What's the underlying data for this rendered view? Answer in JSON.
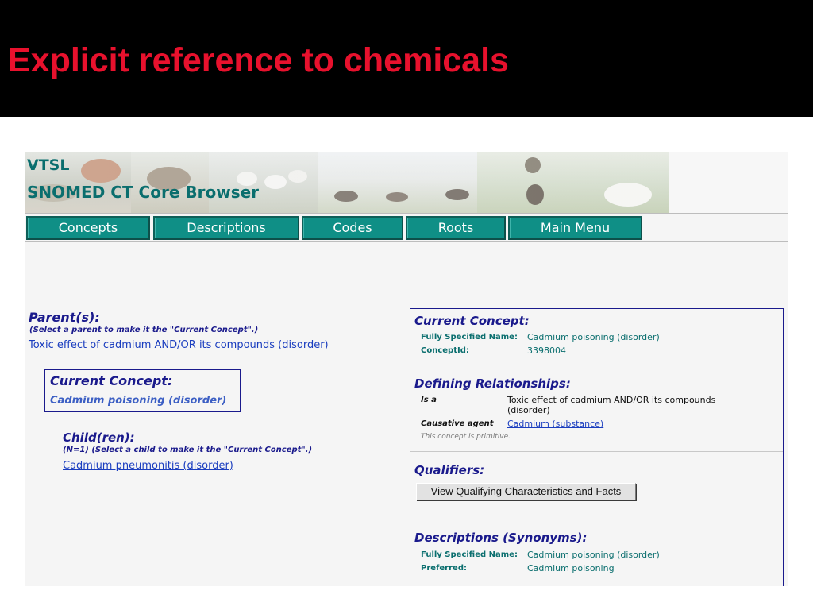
{
  "slide": {
    "title": "Explicit reference to chemicals"
  },
  "browser": {
    "brand": "VTSL",
    "title": "SNOMED CT Core Browser",
    "nav": [
      {
        "label": "Concepts"
      },
      {
        "label": "Descriptions"
      },
      {
        "label": "Codes"
      },
      {
        "label": "Roots"
      },
      {
        "label": "Main Menu"
      }
    ],
    "colors": {
      "accent": "#0f8f86",
      "heading": "#1a1a8c",
      "teal_text": "#0a6e6e",
      "link": "#1a3dbf",
      "slide_title": "#e8112d"
    }
  },
  "left_pane": {
    "parents_heading": "Parent(s):",
    "parents_note": "(Select a parent to make it the \"Current Concept\".)",
    "parent_link": "Toxic effect of cadmium AND/OR its compounds (disorder)",
    "current_concept_label": "Current Concept:",
    "current_concept_value": "Cadmium poisoning (disorder)",
    "children_heading": "Child(ren):",
    "children_note": "(N=1) (Select a child to make it the \"Current Concept\".)",
    "child_link": "Cadmium pneumonitis (disorder)"
  },
  "right_panel": {
    "current_concept": {
      "heading": "Current Concept:",
      "fsn_label": "Fully Specified Name:",
      "fsn_value": "Cadmium poisoning (disorder)",
      "id_label": "ConceptId:",
      "id_value": "3398004"
    },
    "defining_relationships": {
      "heading": "Defining Relationships:",
      "rows": [
        {
          "label": "Is a",
          "value": "Toxic effect of cadmium AND/OR its compounds (disorder)"
        },
        {
          "label": "Causative agent",
          "value": "Cadmium (substance)"
        }
      ],
      "note": "This concept is primitive."
    },
    "qualifiers": {
      "heading": "Qualifiers:",
      "button_label": "View Qualifying Characteristics and Facts"
    },
    "descriptions": {
      "heading": "Descriptions (Synonyms):",
      "fsn_label": "Fully Specified Name:",
      "fsn_value": "Cadmium poisoning (disorder)",
      "preferred_label": "Preferred:",
      "preferred_value": "Cadmium poisoning"
    }
  }
}
